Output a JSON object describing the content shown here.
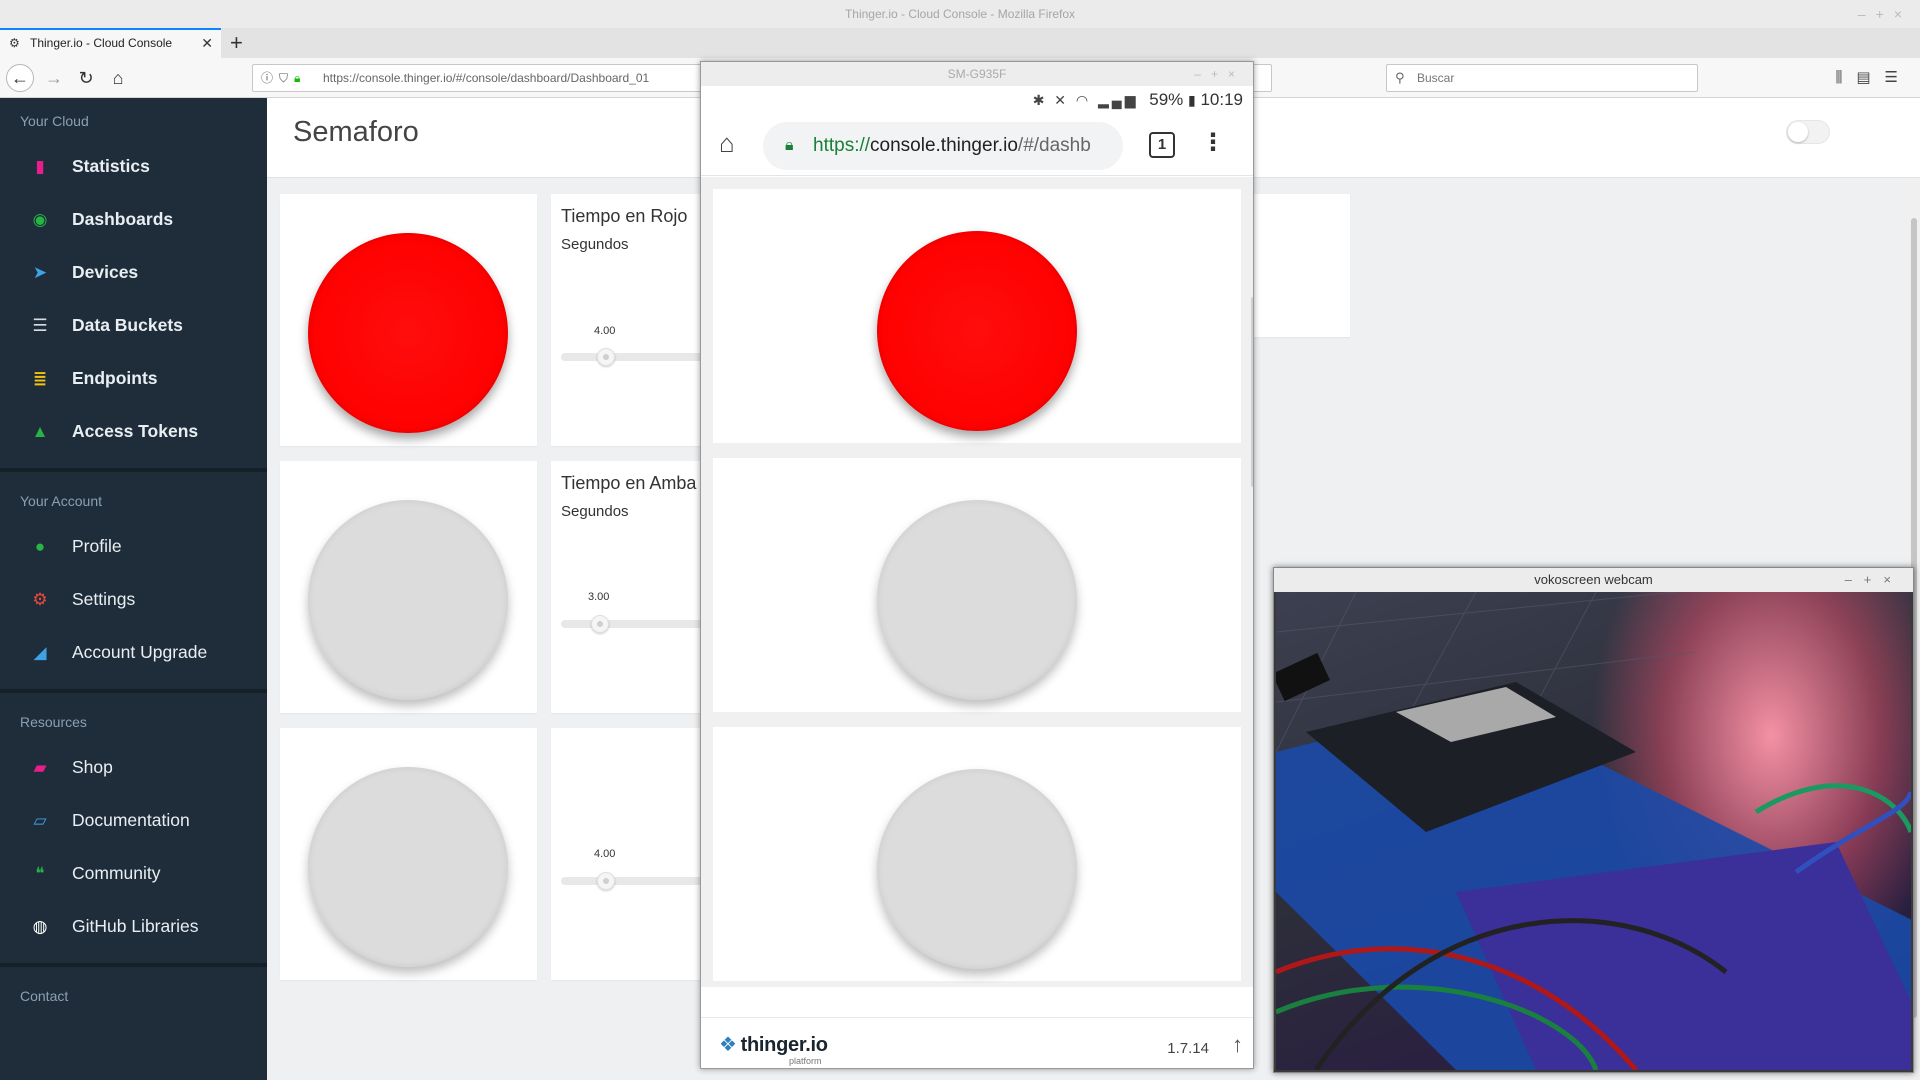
{
  "browser": {
    "window_title": "Thinger.io - Cloud Console - Mozilla Firefox",
    "tab_title": "Thinger.io - Cloud Console",
    "url": "https://console.thinger.io/#/console/dashboard/Dashboard_01",
    "zoom": "%",
    "search_placeholder": "Buscar"
  },
  "sidebar": {
    "sections": [
      {
        "title": "Your Cloud",
        "items": [
          {
            "label": "Statistics",
            "icon": "bar-chart-icon",
            "color": "#e91e8c"
          },
          {
            "label": "Dashboards",
            "icon": "dashboard-icon",
            "color": "#27b345"
          },
          {
            "label": "Devices",
            "icon": "rocket-icon",
            "color": "#3ba3e6"
          },
          {
            "label": "Data Buckets",
            "icon": "database-icon",
            "color": "#d7dde2"
          },
          {
            "label": "Endpoints",
            "icon": "server-icon",
            "color": "#f3c212"
          },
          {
            "label": "Access Tokens",
            "icon": "lock-icon",
            "color": "#27b345"
          }
        ]
      },
      {
        "title": "Your Account",
        "items": [
          {
            "label": "Profile",
            "icon": "user-icon",
            "color": "#27b345"
          },
          {
            "label": "Settings",
            "icon": "gears-icon",
            "color": "#e84a3c"
          },
          {
            "label": "Account Upgrade",
            "icon": "area-chart-icon",
            "color": "#3ba3e6"
          }
        ]
      },
      {
        "title": "Resources",
        "items": [
          {
            "label": "Shop",
            "icon": "shopping-bag-icon",
            "color": "#e91e8c"
          },
          {
            "label": "Documentation",
            "icon": "book-icon",
            "color": "#3ba3e6"
          },
          {
            "label": "Community",
            "icon": "comments-icon",
            "color": "#27b345"
          },
          {
            "label": "GitHub Libraries",
            "icon": "github-icon",
            "color": "#ffffff"
          }
        ]
      },
      {
        "title": "Contact",
        "items": []
      }
    ]
  },
  "dashboard": {
    "title": "Semaforo",
    "sliders": [
      {
        "title": "Tiempo en Rojo",
        "subtitle": "Segundos",
        "value": "4.00",
        "value_num": 4.0
      },
      {
        "title": "Tiempo en Amba",
        "subtitle": "Segundos",
        "value": "3.00",
        "value_num": 3.0
      },
      {
        "title": "",
        "subtitle": "",
        "value": "4.00",
        "value_num": 4.0
      }
    ],
    "leds": [
      {
        "state": "on",
        "color": "#ff0000"
      },
      {
        "state": "off",
        "color": "#dcdcdc"
      },
      {
        "state": "off",
        "color": "#dcdcdc"
      }
    ]
  },
  "phone": {
    "window_title": "SM-G935F",
    "status": {
      "battery": "59%",
      "time": "10:19"
    },
    "url_scheme": "https://",
    "url_host": "console.thinger.io",
    "url_rest": "/#/dashb",
    "tab_count": "1",
    "logo": "thinger.io",
    "logo_sub": "platform",
    "version": "1.7.14"
  },
  "webcam": {
    "window_title": "vokoscreen webcam"
  }
}
